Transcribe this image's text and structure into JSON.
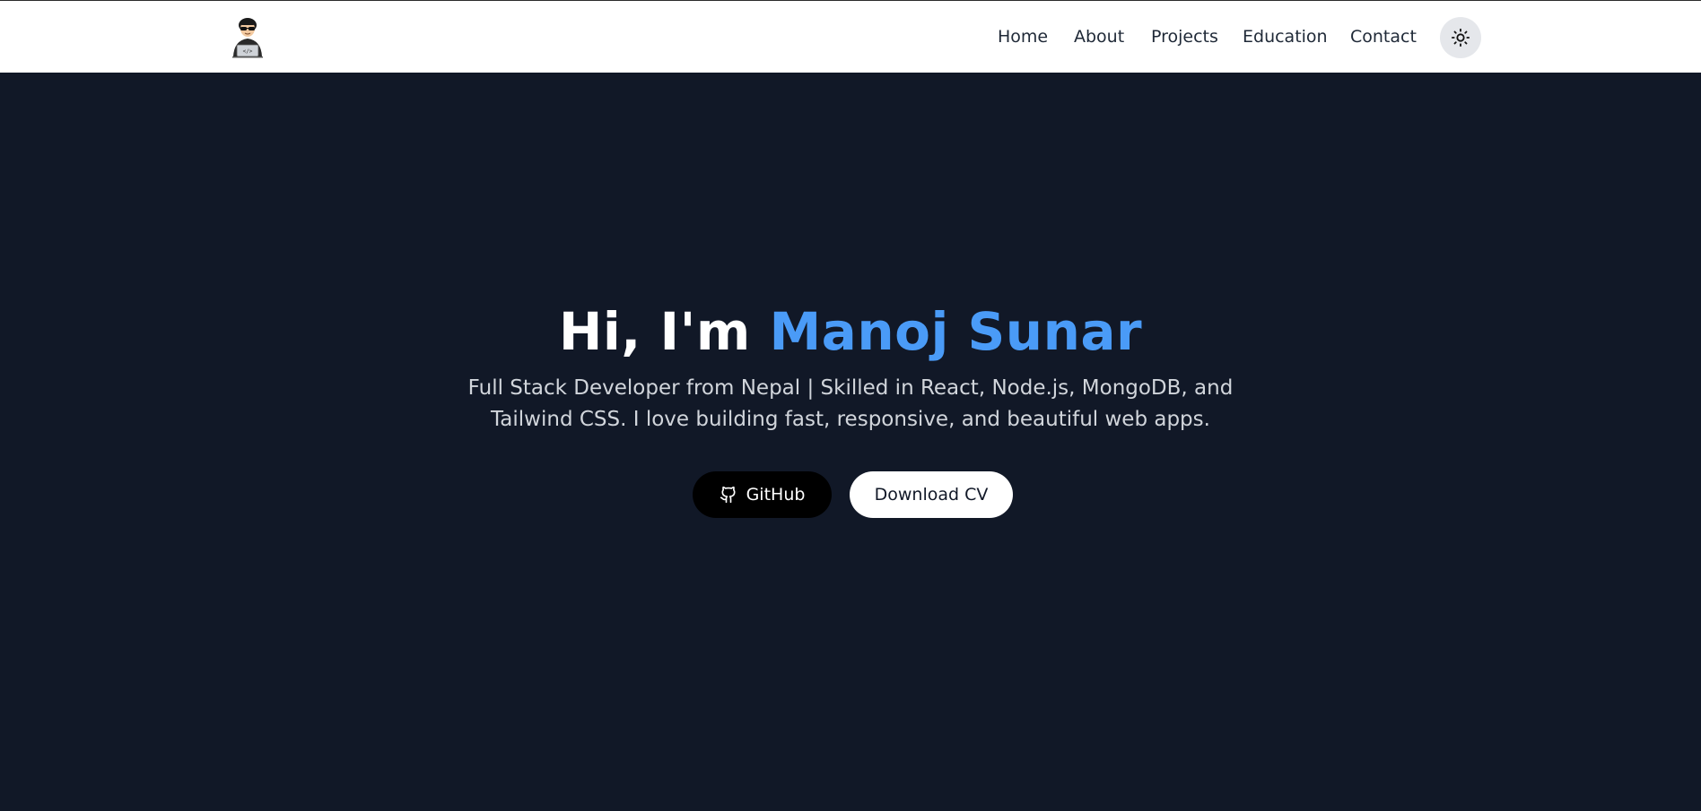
{
  "nav": {
    "logo_icon": "developer-avatar-icon",
    "links": [
      "Home",
      "About",
      "Projects",
      "Education",
      "Contact"
    ],
    "theme_toggle_icon": "sun-icon"
  },
  "hero": {
    "greeting": "Hi, I'm",
    "name": "Manoj Sunar",
    "description_line1": "Full Stack Developer from Nepal | Skilled in React, Node.js, MongoDB, and",
    "description_line2": "Tailwind CSS. I love building fast, responsive, and beautiful web apps.",
    "github_label": "GitHub",
    "github_icon": "github-icon",
    "cv_label": "Download CV"
  },
  "colors": {
    "background": "#111827",
    "accent": "#4a9bf7",
    "navbar": "#ffffff"
  }
}
